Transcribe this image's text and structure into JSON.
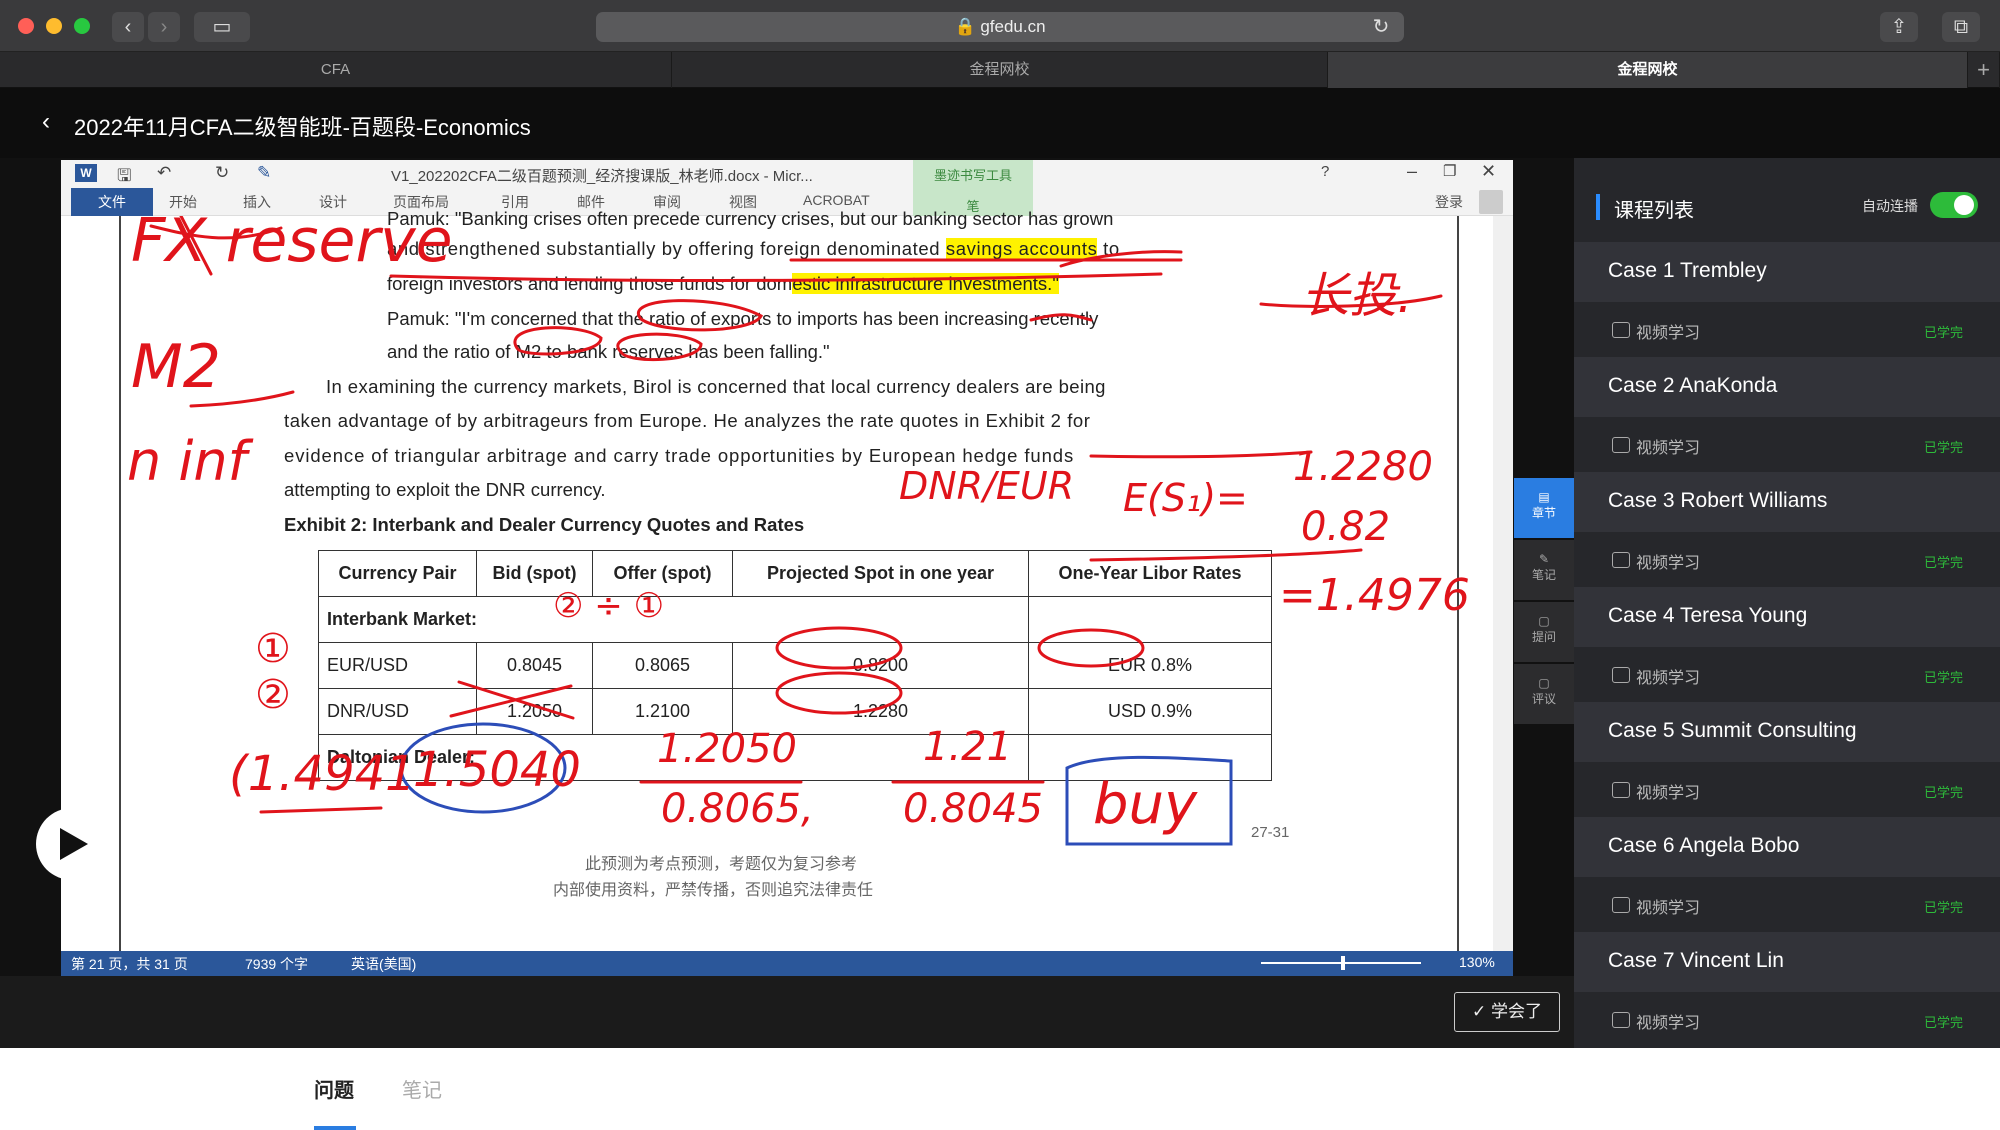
{
  "browser": {
    "url": "gfedu.cn",
    "tabs": [
      "CFA",
      "金程网校",
      "金程网校"
    ]
  },
  "app": {
    "title": "2022年11月CFA二级智能班-百题段-Economics"
  },
  "word": {
    "filename": "V1_202202CFA二级百题预测_经济搜课版_林老师.docx - Micr...",
    "pen_tools": "墨迹书写工具",
    "pen_tab": "笔",
    "login": "登录",
    "ribbon_tabs": [
      "文件",
      "开始",
      "插入",
      "设计",
      "页面布局",
      "引用",
      "邮件",
      "审阅",
      "视图",
      "ACROBAT"
    ],
    "status": {
      "page": "第 21 页，共 31 页",
      "words": "7939 个字",
      "lang": "英语(美国)",
      "zoom": "130%"
    }
  },
  "doc": {
    "line0": "Pamuk: \"Banking crises often precede currency crises, but our banking sector has grown",
    "line1a": "and strengthened substantially by offering foreign denominated ",
    "line1b": "savings accounts",
    "line1c": " to",
    "line2a": "foreign investors and lending those funds for dom",
    "line2b": "estic infrastructure investments.\"",
    "line3": "Pamuk: \"I'm concerned that the ratio of exports to imports has been increasing recently",
    "line4": "and the ratio of M2 to bank reserves has been falling.\"",
    "para1": "In examining the currency markets, Birol is concerned that local currency dealers are being",
    "para2": "taken advantage of by arbitrageurs from Europe. He analyzes the rate quotes in Exhibit 2 for",
    "para3": "evidence of triangular arbitrage and carry trade opportunities by European hedge funds",
    "para4": "attempting to exploit the DNR currency.",
    "exhibit_title": "Exhibit 2: Interbank and Dealer Currency Quotes and Rates",
    "table": {
      "headers": [
        "Currency Pair",
        "Bid (spot)",
        "Offer (spot)",
        "Projected Spot in one year",
        "One-Year Libor Rates"
      ],
      "section1": "Interbank Market:",
      "rows": [
        [
          "EUR/USD",
          "0.8045",
          "0.8065",
          "0.8200",
          "EUR 0.8%"
        ],
        [
          "DNR/USD",
          "1.2050",
          "1.2100",
          "1.2280",
          "USD 0.9%"
        ]
      ],
      "section2": "Daltonian Dealer:"
    },
    "page_num": "27-31",
    "footer1": "此预测为考点预测，考题仅为复习参考",
    "footer2": "内部使用资料，严禁传播，否则追究法律责任"
  },
  "ink": {
    "fx": "FX reserve",
    "m2": "M2",
    "ninf": "n inf",
    "dnr_eur": "DNR/EUR",
    "es": "E(S₁)=",
    "frac_top": "1.2280",
    "frac_bot": "0.82",
    "result": "=1.4976",
    "c1": "①",
    "c2": "②",
    "int_calc": "② ÷ ①",
    "long": "长投.",
    "left_calc": "(1.4941",
    "circled": "1.5040",
    "d1_top": "1.2050",
    "d1_bot": "0.8065,",
    "d2_top": "1.21",
    "d2_bot": "0.8045",
    "buy": "buy"
  },
  "sidetools": [
    "章节",
    "笔记",
    "提问",
    "评议"
  ],
  "panel": {
    "title": "课程列表",
    "autoplay": "自动连播",
    "video_label": "视频学习",
    "done_label": "已学完",
    "cases": [
      "Case 1 Trembley",
      "Case 2 AnaKonda",
      "Case 3 Robert Williams",
      "Case 4 Teresa Young",
      "Case 5 Summit Consulting",
      "Case 6 Angela Bobo",
      "Case 7 Vincent Lin"
    ]
  },
  "learned_btn": "✓ 学会了",
  "bottom_tabs": {
    "questions": "问题",
    "notes": "笔记"
  },
  "colors": {
    "accent": "#2a7de1",
    "ink": "#e0141b",
    "green": "#2dbb3a",
    "word_blue": "#2b579a"
  }
}
